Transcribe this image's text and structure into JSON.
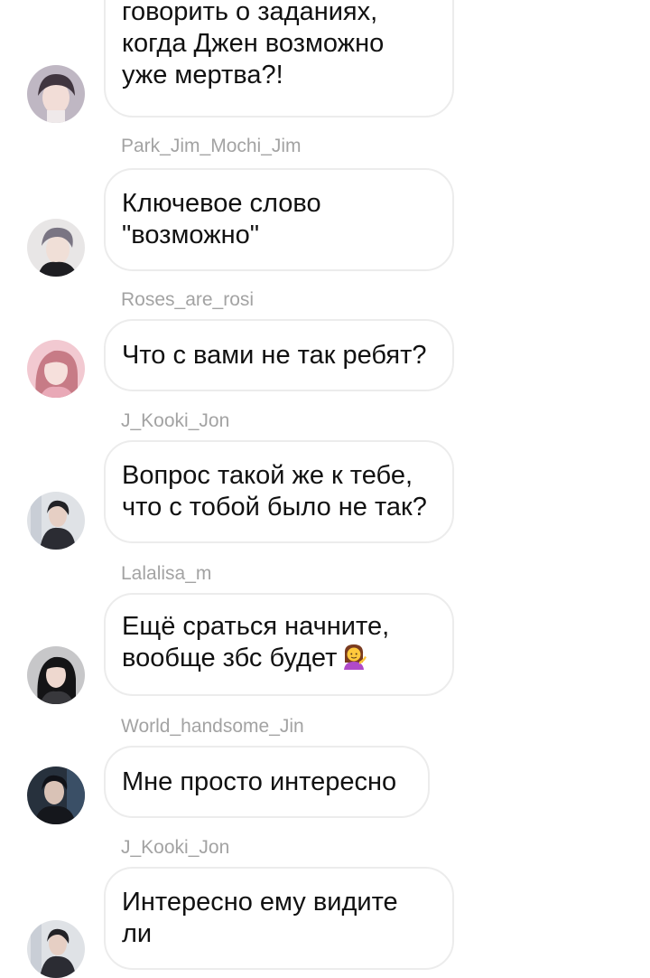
{
  "messages": [
    {
      "sender": "",
      "lines": [
        "говорить о заданиях,",
        "когда Джен возможно",
        "уже мертва?!"
      ],
      "avatar": {
        "icon": "avatar-suga-icon",
        "bg": "#bfb7c3",
        "hair": "#40353f",
        "skin": "#f2ddd7"
      }
    },
    {
      "sender": "Park_Jim_Mochi_Jim",
      "lines": [
        "Ключевое слово",
        "\"возможно\""
      ],
      "avatar": {
        "icon": "avatar-jimin-icon",
        "bg": "#e8e6e6",
        "hair": "#7a7583",
        "skin": "#f0dfd7"
      }
    },
    {
      "sender": "Roses_are_rosi",
      "lines": [
        "Что с вами не так ребят?"
      ],
      "avatar": {
        "icon": "avatar-rose-icon",
        "bg": "#f2c9d1",
        "hair": "#c77b86",
        "skin": "#f6e0dc"
      }
    },
    {
      "sender": "J_Kooki_Jon",
      "lines": [
        "Вопрос такой же к тебе,",
        "что с тобой было не так?"
      ],
      "avatar": {
        "icon": "avatar-jungkook-icon",
        "bg": "#dfe2e6",
        "hair": "#222226",
        "skin": "#e6cfc4"
      }
    },
    {
      "sender": "Lalalisa_m",
      "lines": [
        "Ещё сраться начните,",
        "вообще збс будет"
      ],
      "emoji": "person-tipping-hand-emoji",
      "avatar": {
        "icon": "avatar-lisa-icon",
        "bg": "#c7c7c9",
        "hair": "#141416",
        "skin": "#eed8cf"
      }
    },
    {
      "sender": "World_handsome_Jin",
      "lines": [
        "Мне просто интересно"
      ],
      "avatar": {
        "icon": "avatar-jin-icon",
        "bg": "#27313d",
        "hair": "#101218",
        "skin": "#d9c2b6"
      }
    },
    {
      "sender": "J_Kooki_Jon",
      "lines": [
        "Интересно ему видите",
        "ли"
      ],
      "avatar": {
        "icon": "avatar-jungkook-icon",
        "bg": "#dfe2e6",
        "hair": "#222226",
        "skin": "#e6cfc4"
      }
    }
  ]
}
